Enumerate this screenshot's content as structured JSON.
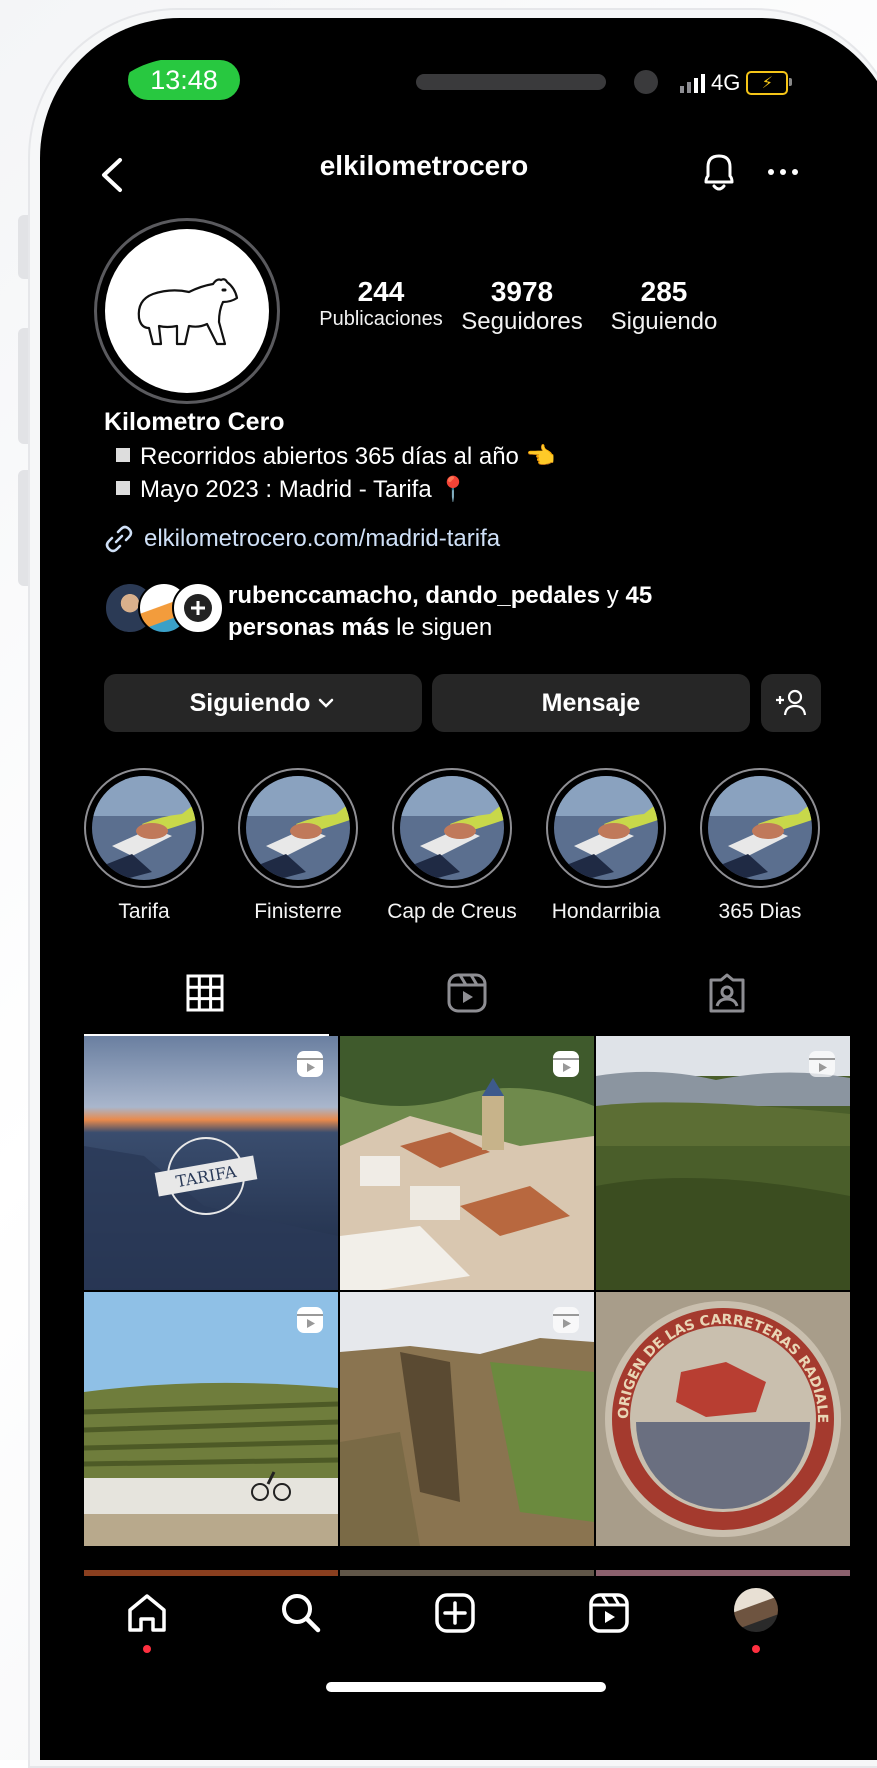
{
  "status": {
    "time": "13:48",
    "network": "4G"
  },
  "header": {
    "username": "elkilometrocero"
  },
  "stats": [
    {
      "value": "244",
      "label": "Publicaciones"
    },
    {
      "value": "3978",
      "label": "Seguidores"
    },
    {
      "value": "285",
      "label": "Siguiendo"
    }
  ],
  "profile": {
    "name": "Kilometro Cero",
    "bio_lines": [
      "Recorridos abiertos 365 días al año 👈",
      "Mayo 2023 : Madrid - Tarifa 📍"
    ],
    "link": "elkilometrocero.com/madrid-tarifa"
  },
  "followed_by": {
    "names": "rubenccamacho, dando_pedales",
    "connector": " y ",
    "others_a": "45",
    "others_b": "personas más",
    "suffix": " le siguen"
  },
  "actions": {
    "following": "Siguiendo",
    "message": "Mensaje"
  },
  "highlights": [
    {
      "label": "Tarifa"
    },
    {
      "label": "Finisterre"
    },
    {
      "label": "Cap de Creus"
    },
    {
      "label": "Hondarribia"
    },
    {
      "label": "365 Dias"
    }
  ],
  "posts": [
    {
      "overlay_text": "TARIFA"
    },
    {},
    {},
    {},
    {},
    {
      "overlay_text": "ORIGEN DE LAS CARRETERAS RADIALES"
    }
  ],
  "colors": {
    "accent_green": "#28c840",
    "battery": "#f5c518",
    "notification_dot": "#ff3040",
    "button_bg": "#262626"
  }
}
